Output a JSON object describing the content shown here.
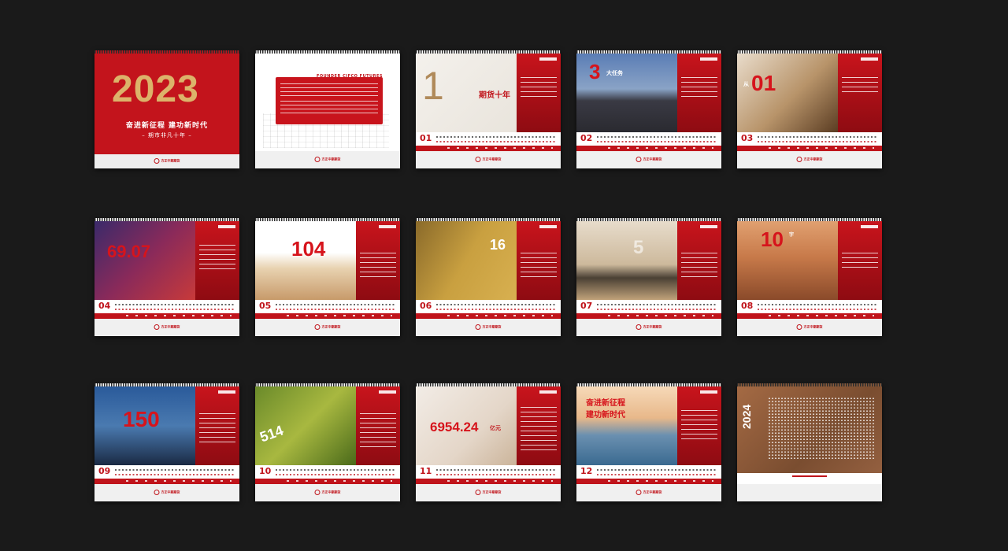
{
  "cover": {
    "year": "2023",
    "slogan": "奋进新征程 建功新时代",
    "subtitle": "– 期市非凡十年 –"
  },
  "intro": {
    "header": "FOUNDER CIFCO FUTURES"
  },
  "brand": "方正中期期货",
  "pages": [
    {
      "month": "01",
      "big": "1",
      "caption": "期货十年"
    },
    {
      "month": "02",
      "big": "3",
      "caption": "大任务"
    },
    {
      "month": "03",
      "big": "01",
      "caption": "从"
    },
    {
      "month": "04",
      "big": "69.07",
      "caption": ""
    },
    {
      "month": "05",
      "big": "104",
      "caption": ""
    },
    {
      "month": "06",
      "big": "16",
      "caption": ""
    },
    {
      "month": "07",
      "big": "5",
      "caption": ""
    },
    {
      "month": "08",
      "big": "10",
      "caption": "字"
    },
    {
      "month": "09",
      "big": "150",
      "caption": ""
    },
    {
      "month": "10",
      "big": "514",
      "caption": ""
    },
    {
      "month": "11",
      "big": "6954.24",
      "caption": "亿元"
    },
    {
      "month": "12",
      "big": "奋进新征程\n建功新时代",
      "caption": ""
    }
  ],
  "back": {
    "year": "2024"
  },
  "colors": {
    "brand_red": "#c3141c",
    "gold": "#dcb36a",
    "background": "#1a1a1a"
  }
}
